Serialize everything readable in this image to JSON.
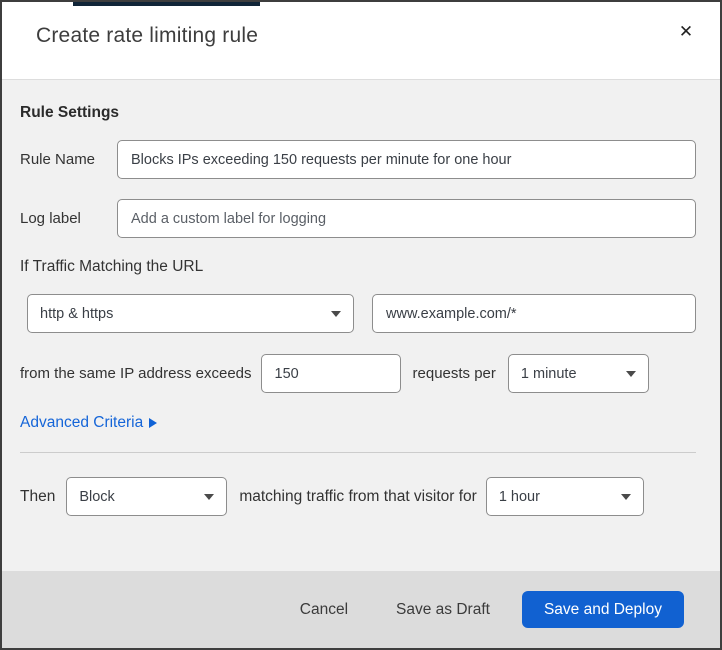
{
  "dialog": {
    "title": "Create rate limiting rule",
    "close_icon": "✕"
  },
  "rule_settings": {
    "heading": "Rule Settings",
    "rule_name": {
      "label": "Rule Name",
      "value": "Blocks IPs exceeding 150 requests per minute for one hour"
    },
    "log_label": {
      "label": "Log label",
      "placeholder": "Add a custom label for logging"
    },
    "traffic_match": {
      "intro": "If Traffic Matching the URL",
      "scheme_selected": "http & https",
      "url_value": "www.example.com/*",
      "threshold_text": "from the same IP address exceeds",
      "threshold_value": "150",
      "per_text": "requests per",
      "period_selected": "1 minute"
    },
    "advanced_criteria_label": "Advanced Criteria"
  },
  "then_section": {
    "then_label": "Then",
    "action_selected": "Block",
    "middle_text": "matching traffic from that visitor for",
    "duration_selected": "1 hour"
  },
  "footer": {
    "cancel_label": "Cancel",
    "save_draft_label": "Save as Draft",
    "save_deploy_label": "Save and Deploy"
  },
  "colors": {
    "primary_blue": "#1161d1",
    "link_blue": "#1565d8",
    "footer_gray": "#dcdcdc",
    "body_gray": "#f1f1f1"
  }
}
